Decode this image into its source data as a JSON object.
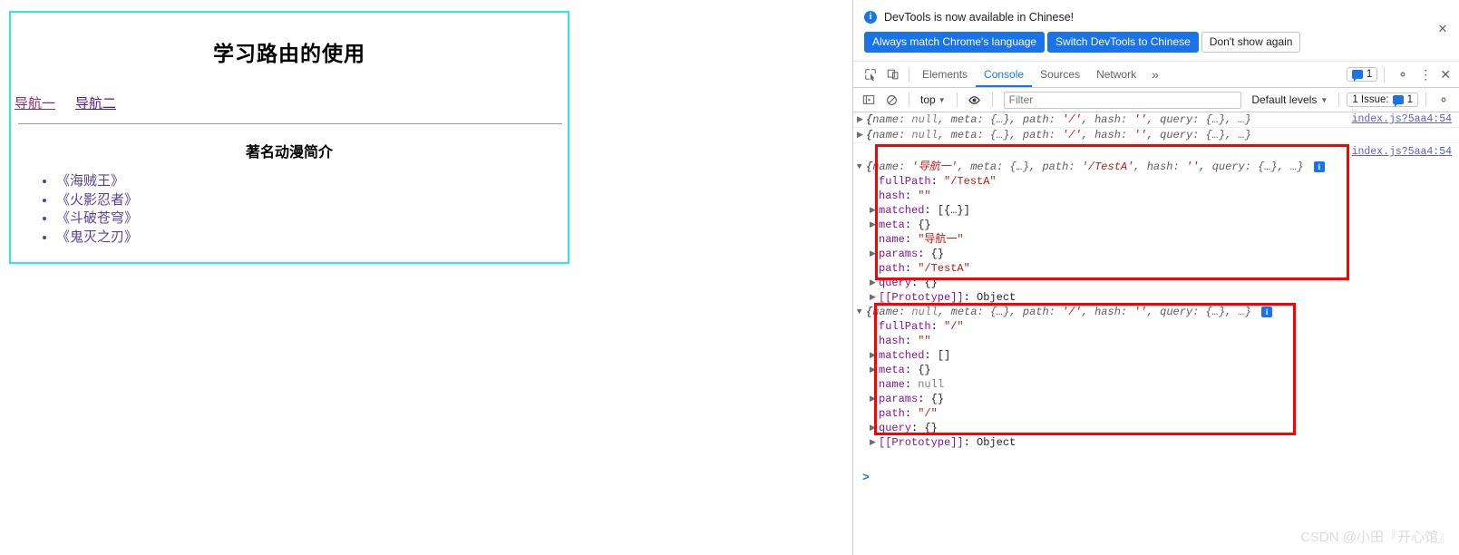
{
  "page": {
    "title": "学习路由的使用",
    "nav": [
      {
        "label": "导航一",
        "state": "active"
      },
      {
        "label": "导航二",
        "state": "visited"
      }
    ],
    "section_title": "著名动漫简介",
    "list": [
      "《海贼王》",
      "《火影忍者》",
      "《斗破苍穹》",
      "《鬼灭之刃》"
    ]
  },
  "devtools": {
    "notification": {
      "icon": "info-icon",
      "message": "DevTools is now available in Chinese!",
      "buttons": [
        {
          "label": "Always match Chrome's language",
          "style": "primary"
        },
        {
          "label": "Switch DevTools to Chinese",
          "style": "primary"
        },
        {
          "label": "Don't show again",
          "style": "secondary"
        }
      ],
      "close_label": "✕"
    },
    "tabs": {
      "inspect_icon": "inspect-element-icon",
      "device_icon": "device-toolbar-icon",
      "items": [
        {
          "label": "Elements",
          "selected": false
        },
        {
          "label": "Console",
          "selected": true
        },
        {
          "label": "Sources",
          "selected": false
        },
        {
          "label": "Network",
          "selected": false
        }
      ],
      "more_label": "»",
      "issues_count": "1",
      "settings_icon": "gear-icon",
      "more_options_icon": "kebab-menu-icon",
      "close_icon": "close-icon"
    },
    "filterbar": {
      "sidebar_icon": "console-sidebar-icon",
      "clear_icon": "clear-console-icon",
      "context_value": "top",
      "eye_icon": "live-expression-icon",
      "filter_placeholder": "Filter",
      "filter_value": "",
      "levels_value": "Default levels",
      "issues_label": "1 Issue:",
      "issues_count": "1",
      "settings_icon": "gear-icon"
    },
    "console": {
      "source_link": "index.js?5aa4:54",
      "prompt": ">",
      "messages": [
        {
          "id": "m1",
          "expanded": false,
          "preview": [
            {
              "k": "name",
              "v": "null",
              "t": "null"
            },
            {
              "k": "meta",
              "v": "{…}",
              "t": "plain"
            },
            {
              "k": "path",
              "v": "'/'",
              "t": "str"
            },
            {
              "k": "hash",
              "v": "''",
              "t": "str"
            },
            {
              "k": "query",
              "v": "{…}",
              "t": "plain"
            }
          ],
          "tail": "…",
          "source": "index.js?5aa4:54",
          "has_info_badge": false
        },
        {
          "id": "m2",
          "expanded": false,
          "preview": [
            {
              "k": "name",
              "v": "null",
              "t": "null"
            },
            {
              "k": "meta",
              "v": "{…}",
              "t": "plain"
            },
            {
              "k": "path",
              "v": "'/'",
              "t": "str"
            },
            {
              "k": "hash",
              "v": "''",
              "t": "str"
            },
            {
              "k": "query",
              "v": "{…}",
              "t": "plain"
            }
          ],
          "tail": "…",
          "source": "",
          "has_info_badge": false
        },
        {
          "id": "m3",
          "expanded": true,
          "preview": [
            {
              "k": "name",
              "v": "'导航一'",
              "t": "str"
            },
            {
              "k": "meta",
              "v": "{…}",
              "t": "plain"
            },
            {
              "k": "path",
              "v": "'/TestA'",
              "t": "str"
            },
            {
              "k": "hash",
              "v": "''",
              "t": "str"
            },
            {
              "k": "query",
              "v": "{…}",
              "t": "plain"
            }
          ],
          "tail": "…",
          "source": "index.js?5aa4:54",
          "has_info_badge": true,
          "props": [
            {
              "arrow": "",
              "name": "fullPath",
              "value": "\"/TestA\"",
              "t": "str"
            },
            {
              "arrow": "",
              "name": "hash",
              "value": "\"\"",
              "t": "str"
            },
            {
              "arrow": "▶",
              "name": "matched",
              "value": "[{…}]",
              "t": "plain"
            },
            {
              "arrow": "▶",
              "name": "meta",
              "value": "{}",
              "t": "plain"
            },
            {
              "arrow": "",
              "name": "name",
              "value": "\"导航一\"",
              "t": "str"
            },
            {
              "arrow": "▶",
              "name": "params",
              "value": "{}",
              "t": "plain"
            },
            {
              "arrow": "",
              "name": "path",
              "value": "\"/TestA\"",
              "t": "str"
            },
            {
              "arrow": "▶",
              "name": "query",
              "value": "{}",
              "t": "plain"
            },
            {
              "arrow": "▶",
              "name": "[[Prototype]]",
              "value": "Object",
              "t": "plain"
            }
          ]
        },
        {
          "id": "m4",
          "expanded": true,
          "preview": [
            {
              "k": "name",
              "v": "null",
              "t": "null"
            },
            {
              "k": "meta",
              "v": "{…}",
              "t": "plain"
            },
            {
              "k": "path",
              "v": "'/'",
              "t": "str"
            },
            {
              "k": "hash",
              "v": "''",
              "t": "str"
            },
            {
              "k": "query",
              "v": "{…}",
              "t": "plain"
            }
          ],
          "tail": "…",
          "source": "",
          "has_info_badge": true,
          "props": [
            {
              "arrow": "",
              "name": "fullPath",
              "value": "\"/\"",
              "t": "str"
            },
            {
              "arrow": "",
              "name": "hash",
              "value": "\"\"",
              "t": "str"
            },
            {
              "arrow": "▶",
              "name": "matched",
              "value": "[]",
              "t": "plain"
            },
            {
              "arrow": "▶",
              "name": "meta",
              "value": "{}",
              "t": "plain"
            },
            {
              "arrow": "",
              "name": "name",
              "value": "null",
              "t": "null"
            },
            {
              "arrow": "▶",
              "name": "params",
              "value": "{}",
              "t": "plain"
            },
            {
              "arrow": "",
              "name": "path",
              "value": "\"/\"",
              "t": "str"
            },
            {
              "arrow": "▶",
              "name": "query",
              "value": "{}",
              "t": "plain"
            },
            {
              "arrow": "▶",
              "name": "[[Prototype]]",
              "value": "Object",
              "t": "plain"
            }
          ]
        }
      ]
    }
  },
  "watermark": "CSDN @小田『开心馆』",
  "colors": {
    "accent": "#1a73e8",
    "page_border": "#2ee6e6",
    "link_visited": "#551a8b",
    "link_active": "#8b2b6b",
    "highlight_box": "#ff0000",
    "string": "#c41a16",
    "property": "#881391"
  }
}
